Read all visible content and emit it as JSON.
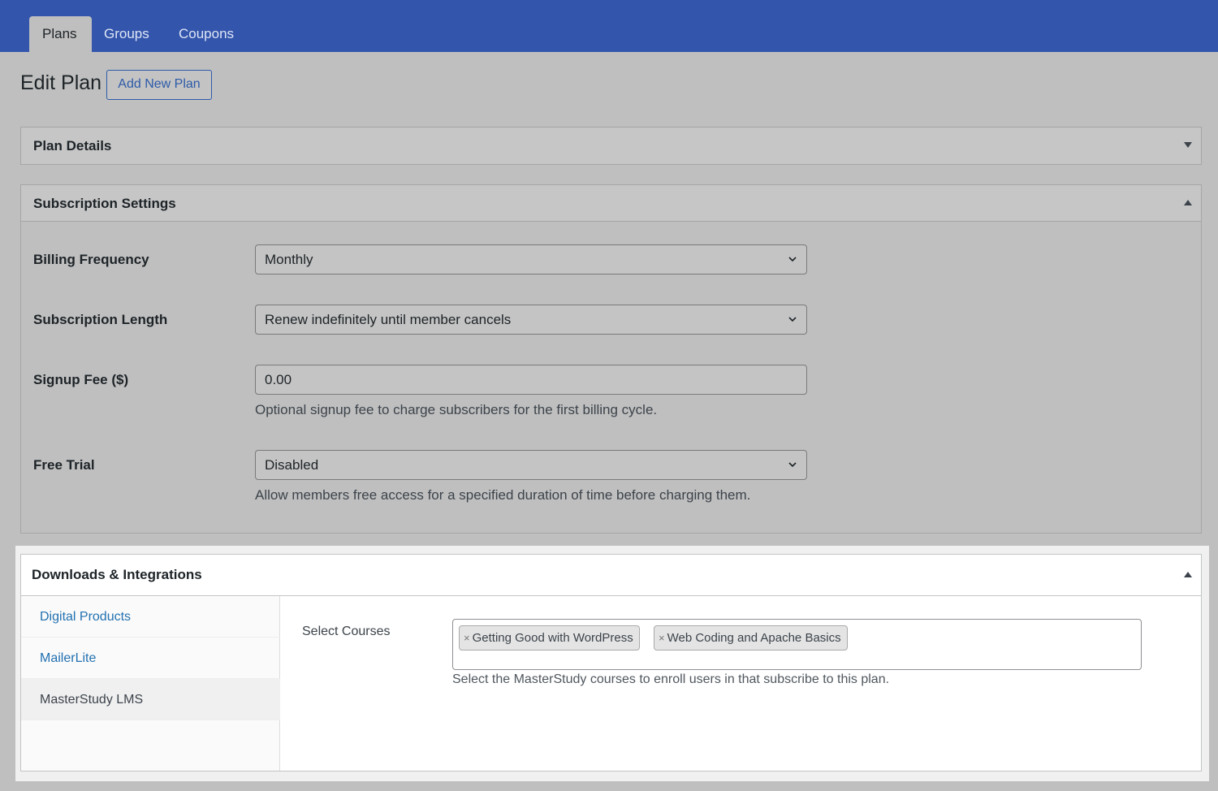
{
  "tabs": [
    {
      "label": "Plans",
      "active": true
    },
    {
      "label": "Groups",
      "active": false
    },
    {
      "label": "Coupons",
      "active": false
    }
  ],
  "header": {
    "title": "Edit Plan",
    "add_new_label": "Add New Plan"
  },
  "plan_details": {
    "title": "Plan Details",
    "toggle_icon": "triangle-down-icon"
  },
  "subscription_settings": {
    "title": "Subscription Settings",
    "toggle_icon": "triangle-up-icon",
    "billing_frequency": {
      "label": "Billing Frequency",
      "value": "Monthly"
    },
    "subscription_length": {
      "label": "Subscription Length",
      "value": "Renew indefinitely until member cancels"
    },
    "signup_fee": {
      "label": "Signup Fee ($)",
      "value": "0.00",
      "description": "Optional signup fee to charge subscribers for the first billing cycle."
    },
    "free_trial": {
      "label": "Free Trial",
      "value": "Disabled",
      "description": "Allow members free access for a specified duration of time before charging them."
    }
  },
  "downloads": {
    "title": "Downloads & Integrations",
    "toggle_icon": "triangle-up-icon",
    "nav": [
      {
        "label": "Digital Products",
        "active": false
      },
      {
        "label": "MailerLite",
        "active": false
      },
      {
        "label": "MasterStudy LMS",
        "active": true
      }
    ],
    "select_courses": {
      "label": "Select Courses",
      "selected": [
        "Getting Good with WordPress",
        "Web Coding and Apache Basics"
      ],
      "remove_glyph": "×",
      "description": "Select the MasterStudy courses to enroll users in that subscribe to this plan."
    }
  },
  "colors": {
    "topbar": "#3355ac",
    "link": "#2271b1",
    "button_border": "#2c5aa8"
  }
}
